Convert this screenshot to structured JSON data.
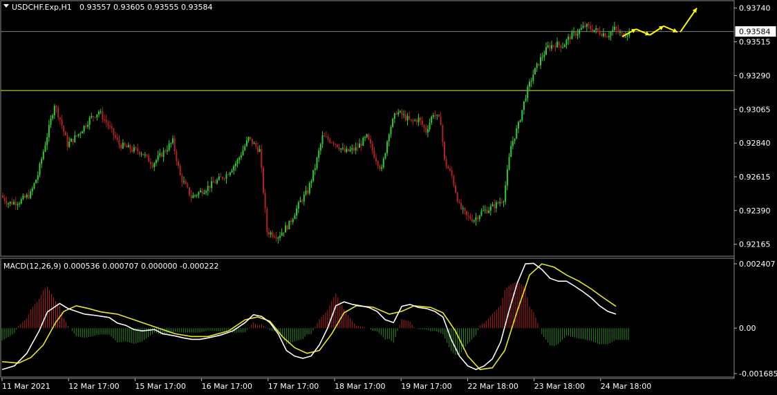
{
  "header": {
    "symbol": "USDCHF.Exp,H1",
    "ohlc": "0.93557 0.93605 0.93555 0.93584"
  },
  "macd_header": "MACD(12,26,9) 0.000536 0.000707 0.000000 -0.000222",
  "colors": {
    "background": "#000000",
    "bull_candle": "#32cd32",
    "bear_candle": "#b22222",
    "level_line": "#e8e840",
    "bid_line": "#808080",
    "macd_line": "#ffffff",
    "signal_line": "#e8e820",
    "hist_up": "#b22222",
    "hist_down": "#2e8b22",
    "arrow": "#ffff00",
    "axis": "#c0c0c0"
  },
  "chart_data": {
    "type": "candlestick",
    "price_axis": {
      "ticks": [
        "0.93740",
        "0.93515",
        "0.93290",
        "0.93065",
        "0.92840",
        "0.92615",
        "0.92390",
        "0.92165"
      ],
      "range": [
        0.9209,
        0.9378
      ]
    },
    "current_price": "0.93584",
    "horizontal_level": 0.9319,
    "time_labels": [
      "11 Mar 2021",
      "12 Mar 17:00",
      "15 Mar 17:00",
      "16 Mar 17:00",
      "17 Mar 17:00",
      "18 Mar 17:00",
      "19 Mar 17:00",
      "22 Mar 18:00",
      "23 Mar 18:00",
      "24 Mar 18:00"
    ],
    "price_path": [
      [
        0,
        0.9249
      ],
      [
        4,
        0.9244
      ],
      [
        10,
        0.9245
      ],
      [
        16,
        0.925
      ],
      [
        20,
        0.9263
      ],
      [
        26,
        0.9294
      ],
      [
        29,
        0.931
      ],
      [
        32,
        0.93
      ],
      [
        36,
        0.9283
      ],
      [
        42,
        0.929
      ],
      [
        48,
        0.93
      ],
      [
        53,
        0.9305
      ],
      [
        58,
        0.9296
      ],
      [
        64,
        0.9283
      ],
      [
        70,
        0.928
      ],
      [
        76,
        0.9278
      ],
      [
        82,
        0.927
      ],
      [
        88,
        0.9278
      ],
      [
        93,
        0.9285
      ],
      [
        97,
        0.9262
      ],
      [
        103,
        0.9248
      ],
      [
        110,
        0.9253
      ],
      [
        116,
        0.9258
      ],
      [
        122,
        0.9263
      ],
      [
        128,
        0.9272
      ],
      [
        134,
        0.9287
      ],
      [
        140,
        0.9279
      ],
      [
        144,
        0.9225
      ],
      [
        150,
        0.9222
      ],
      [
        156,
        0.923
      ],
      [
        162,
        0.9245
      ],
      [
        166,
        0.9252
      ],
      [
        170,
        0.9268
      ],
      [
        174,
        0.9288
      ],
      [
        180,
        0.9285
      ],
      [
        186,
        0.9278
      ],
      [
        192,
        0.928
      ],
      [
        198,
        0.9288
      ],
      [
        202,
        0.9276
      ],
      [
        206,
        0.9266
      ],
      [
        210,
        0.9292
      ],
      [
        214,
        0.9305
      ],
      [
        218,
        0.9302
      ],
      [
        222,
        0.9298
      ],
      [
        226,
        0.93
      ],
      [
        230,
        0.9292
      ],
      [
        234,
        0.9304
      ],
      [
        238,
        0.9298
      ],
      [
        240,
        0.9272
      ],
      [
        244,
        0.9262
      ],
      [
        248,
        0.9242
      ],
      [
        252,
        0.9235
      ],
      [
        256,
        0.9233
      ],
      [
        260,
        0.9238
      ],
      [
        264,
        0.924
      ],
      [
        268,
        0.9243
      ],
      [
        272,
        0.9247
      ],
      [
        276,
        0.9282
      ],
      [
        280,
        0.9296
      ],
      [
        284,
        0.9316
      ],
      [
        288,
        0.933
      ],
      [
        292,
        0.934
      ],
      [
        296,
        0.9348
      ],
      [
        300,
        0.935
      ],
      [
        304,
        0.9349
      ],
      [
        308,
        0.9355
      ],
      [
        312,
        0.9358
      ],
      [
        316,
        0.9362
      ],
      [
        320,
        0.936
      ],
      [
        324,
        0.9358
      ],
      [
        328,
        0.9356
      ],
      [
        332,
        0.936
      ],
      [
        336,
        0.9356
      ],
      [
        340,
        0.9358
      ]
    ],
    "projection_arrows": [
      [
        0.9355,
        0.936
      ],
      [
        0.936,
        0.9356
      ],
      [
        0.9356,
        0.9362
      ],
      [
        0.9362,
        0.9358
      ],
      [
        0.9358,
        0.9374
      ]
    ],
    "macd_axis": {
      "ticks": [
        "0.002407",
        "0.00",
        "-0.001685"
      ],
      "range": [
        -0.00175,
        0.00245
      ]
    },
    "macd_main": [
      [
        0,
        -0.00148
      ],
      [
        6,
        -0.00135
      ],
      [
        12,
        -0.0009
      ],
      [
        18,
        -0.0001
      ],
      [
        22,
        0.00058
      ],
      [
        28,
        0.00088
      ],
      [
        32,
        0.0007
      ],
      [
        36,
        0.0006
      ],
      [
        40,
        0.0005
      ],
      [
        46,
        0.00045
      ],
      [
        52,
        0.00038
      ],
      [
        56,
        0.00018
      ],
      [
        60,
        0.0001
      ],
      [
        64,
        -5e-05
      ],
      [
        68,
        -0.0001
      ],
      [
        74,
        -5e-05
      ],
      [
        78,
        -0.0002
      ],
      [
        84,
        -0.00028
      ],
      [
        88,
        -0.00035
      ],
      [
        92,
        -0.0004
      ],
      [
        96,
        -0.0004
      ],
      [
        100,
        -0.00035
      ],
      [
        106,
        -0.00025
      ],
      [
        112,
        -0.0001
      ],
      [
        118,
        0.0002
      ],
      [
        122,
        0.00048
      ],
      [
        126,
        0.00042
      ],
      [
        130,
        0.0002
      ],
      [
        134,
        -0.0002
      ],
      [
        138,
        -0.0008
      ],
      [
        142,
        -0.001
      ],
      [
        146,
        -0.00108
      ],
      [
        150,
        -0.001
      ],
      [
        154,
        -0.0006
      ],
      [
        158,
        0.0
      ],
      [
        162,
        0.0008
      ],
      [
        166,
        0.00094
      ],
      [
        170,
        0.00085
      ],
      [
        174,
        0.0008
      ],
      [
        178,
        0.00074
      ],
      [
        182,
        0.0006
      ],
      [
        186,
        0.0003
      ],
      [
        190,
        0.0002
      ],
      [
        194,
        0.00078
      ],
      [
        198,
        0.00085
      ],
      [
        202,
        0.00074
      ],
      [
        206,
        0.0007
      ],
      [
        210,
        0.0006
      ],
      [
        214,
        0.0004
      ],
      [
        218,
        -0.0004
      ],
      [
        222,
        -0.001
      ],
      [
        226,
        -0.00135
      ],
      [
        230,
        -0.00148
      ],
      [
        234,
        -0.00135
      ],
      [
        238,
        -0.0011
      ],
      [
        242,
        -0.0005
      ],
      [
        246,
        0.0006
      ],
      [
        250,
        0.0016
      ],
      [
        254,
        0.0023
      ],
      [
        258,
        0.00232
      ],
      [
        262,
        0.0021
      ],
      [
        266,
        0.00178
      ],
      [
        270,
        0.00168
      ],
      [
        274,
        0.00168
      ],
      [
        278,
        0.0015
      ],
      [
        282,
        0.0013
      ],
      [
        286,
        0.00108
      ],
      [
        290,
        0.0008
      ],
      [
        294,
        0.0006
      ],
      [
        298,
        0.0005
      ]
    ],
    "macd_signal": [
      [
        0,
        -0.0012
      ],
      [
        8,
        -0.00125
      ],
      [
        14,
        -0.00105
      ],
      [
        20,
        -0.0006
      ],
      [
        26,
        0.0002
      ],
      [
        30,
        0.0006
      ],
      [
        36,
        0.0008
      ],
      [
        42,
        0.0007
      ],
      [
        48,
        0.00058
      ],
      [
        56,
        0.0005
      ],
      [
        62,
        0.00035
      ],
      [
        68,
        0.0002
      ],
      [
        76,
        0.0
      ],
      [
        84,
        -0.0002
      ],
      [
        92,
        -0.0003
      ],
      [
        100,
        -0.0003
      ],
      [
        110,
        -0.0001
      ],
      [
        118,
        0.0003
      ],
      [
        124,
        0.0004
      ],
      [
        130,
        0.00025
      ],
      [
        136,
        -0.0003
      ],
      [
        142,
        -0.0007
      ],
      [
        148,
        -0.0009
      ],
      [
        154,
        -0.0008
      ],
      [
        160,
        -0.0002
      ],
      [
        166,
        0.00055
      ],
      [
        172,
        0.0008
      ],
      [
        180,
        0.00075
      ],
      [
        188,
        0.0005
      ],
      [
        194,
        0.0006
      ],
      [
        200,
        0.0008
      ],
      [
        208,
        0.00074
      ],
      [
        214,
        0.00055
      ],
      [
        220,
        -0.0001
      ],
      [
        226,
        -0.001
      ],
      [
        232,
        -0.00148
      ],
      [
        238,
        -0.00142
      ],
      [
        244,
        -0.0008
      ],
      [
        250,
        0.0006
      ],
      [
        256,
        0.0019
      ],
      [
        262,
        0.0023
      ],
      [
        268,
        0.00218
      ],
      [
        274,
        0.0019
      ],
      [
        280,
        0.00168
      ],
      [
        286,
        0.0014
      ],
      [
        292,
        0.00108
      ],
      [
        298,
        0.00078
      ]
    ]
  }
}
